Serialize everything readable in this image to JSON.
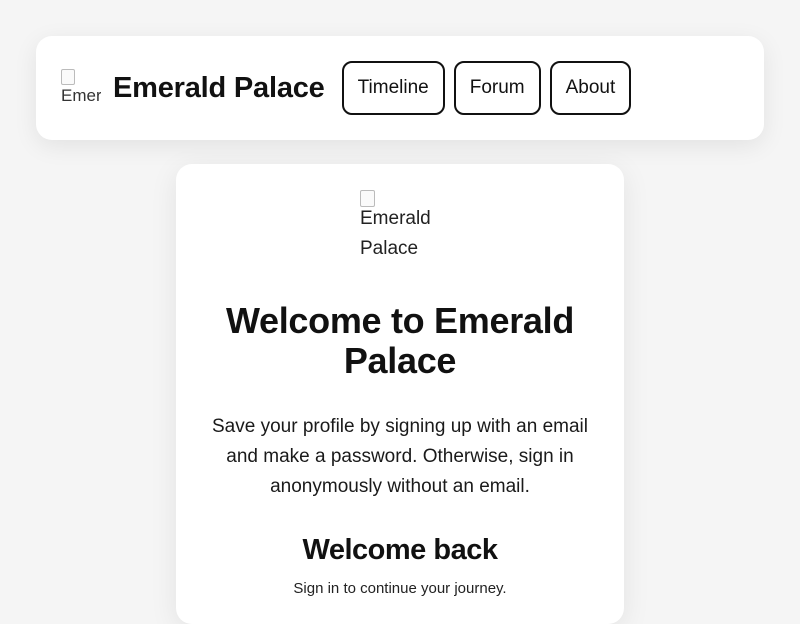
{
  "navbar": {
    "logo_alt": "Emerald Palace",
    "brand": "Emerald Palace",
    "links": [
      {
        "label": "Timeline"
      },
      {
        "label": "Forum"
      },
      {
        "label": "About"
      }
    ]
  },
  "card": {
    "logo_alt": "Emerald Palace",
    "title": "Welcome to Emerald Palace",
    "description": "Save your profile by signing up with an email and make a password. Otherwise, sign in anonymously without an email.",
    "signin_title": "Welcome back",
    "signin_subtitle": "Sign in to continue your journey."
  }
}
